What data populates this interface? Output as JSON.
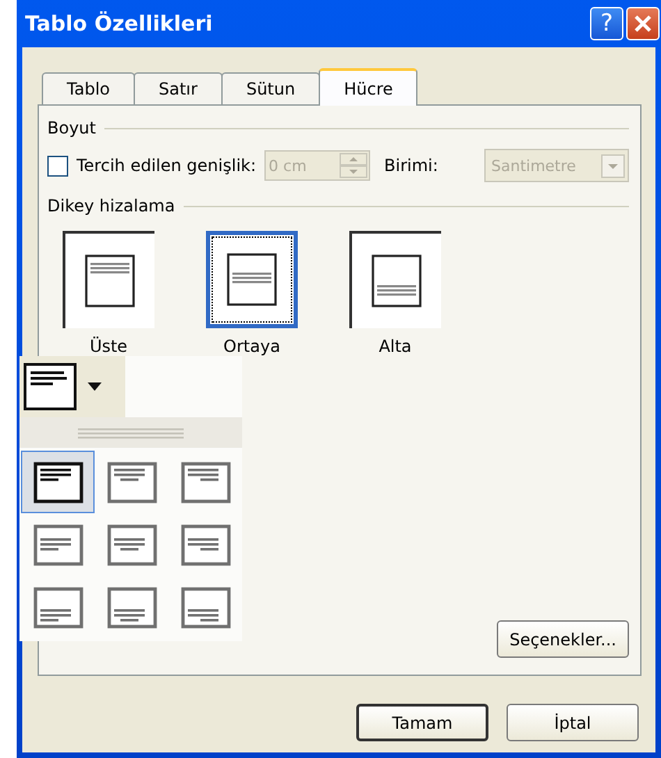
{
  "window": {
    "title": "Tablo Özellikleri",
    "help": "?"
  },
  "tabs": [
    {
      "label": "Tablo",
      "selected": false
    },
    {
      "label": "Satır",
      "selected": false
    },
    {
      "label": "Sütun",
      "selected": false
    },
    {
      "label": "Hücre",
      "selected": true
    }
  ],
  "size": {
    "title": "Boyut",
    "preferred_width": {
      "label": "Tercih edilen genişlik:",
      "checked": false,
      "value": "0 cm",
      "disabled": true
    },
    "unit": {
      "label": "Birimi:",
      "value": "Santimetre",
      "disabled": true
    }
  },
  "vertical_alignment": {
    "title": "Dikey hizalama",
    "options": [
      {
        "label": "Üste",
        "kind": "top",
        "selected": false
      },
      {
        "label": "Ortaya",
        "kind": "middle",
        "selected": true
      },
      {
        "label": "Alta",
        "kind": "bottom",
        "selected": false
      }
    ]
  },
  "alignment_popup": {
    "cells": [
      {
        "kind": "top-left",
        "selected": true
      },
      {
        "kind": "top-center",
        "selected": false
      },
      {
        "kind": "top-right",
        "selected": false
      },
      {
        "kind": "middle-left",
        "selected": false
      },
      {
        "kind": "middle-center",
        "selected": false
      },
      {
        "kind": "middle-right",
        "selected": false
      },
      {
        "kind": "bottom-left",
        "selected": false
      },
      {
        "kind": "bottom-center",
        "selected": false
      },
      {
        "kind": "bottom-right",
        "selected": false
      }
    ]
  },
  "options_button": "Seçenekler...",
  "buttons": [
    "Tamam",
    "İptal"
  ]
}
